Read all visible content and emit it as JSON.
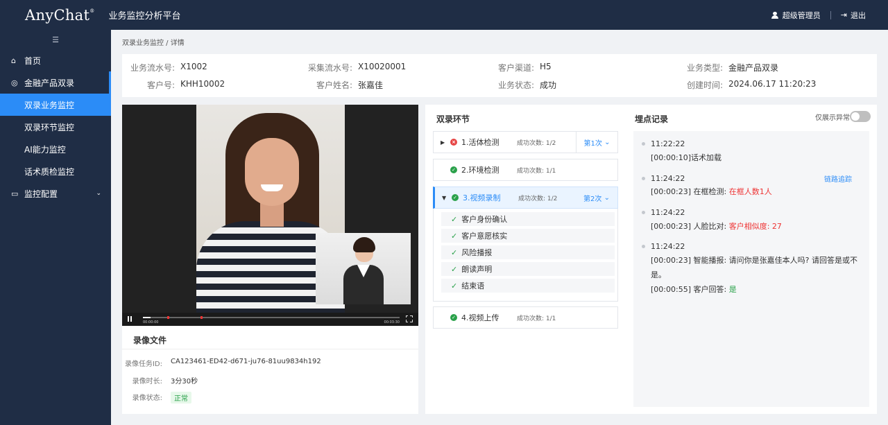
{
  "header": {
    "logo": "AnyChat",
    "logo_mark": "®",
    "platform_title": "业务监控分析平台",
    "user_name": "超级管理员",
    "logout_label": "退出"
  },
  "sidebar": {
    "items": [
      {
        "label": "首页"
      },
      {
        "label": "金融产品双录"
      },
      {
        "label": "双录业务监控"
      },
      {
        "label": "双录环节监控"
      },
      {
        "label": "AI能力监控"
      },
      {
        "label": "话术质检监控"
      },
      {
        "label": "监控配置"
      }
    ]
  },
  "breadcrumb": "双录业务监控 / 详情",
  "info": {
    "fields": [
      {
        "label": "业务流水号:",
        "value": "X1002"
      },
      {
        "label": "采集流水号:",
        "value": "X10020001"
      },
      {
        "label": "客户渠道:",
        "value": "H5"
      },
      {
        "label": "业务类型:",
        "value": "金融产品双录"
      },
      {
        "label": "客户号:",
        "value": "KHH10002"
      },
      {
        "label": "客户姓名:",
        "value": "张嘉佳"
      },
      {
        "label": "业务状态:",
        "value": "成功"
      },
      {
        "label": "创建时间:",
        "value": "2024.06.17  11:20:23"
      }
    ]
  },
  "video": {
    "time_current": "00:00:00",
    "time_total": "00:03:30",
    "progress": 0.03
  },
  "recording": {
    "title": "录像文件",
    "task_id_label": "录像任务ID:",
    "task_id": "CA123461-ED42-d671-ju76-81uu9834h192",
    "duration_label": "录像时长:",
    "duration": "3分30秒",
    "status_label": "录像状态:",
    "status": "正常"
  },
  "steps": {
    "title": "双录环节",
    "items": [
      {
        "name": "1.活体检测",
        "count": "成功次数: 1/2",
        "turn": "第1次"
      },
      {
        "name": "2.环境检测",
        "count": "成功次数: 1/1"
      },
      {
        "name": "3.视频录制",
        "count": "成功次数: 1/2",
        "turn": "第2次"
      },
      {
        "name": "4.视频上传",
        "count": "成功次数: 1/1"
      }
    ],
    "substeps": [
      "客户身份确认",
      "客户意愿核实",
      "风险播报",
      "朗读声明",
      "结束语"
    ]
  },
  "logs": {
    "title": "埋点记录",
    "filter_label": "仅展示异常",
    "trace_label": "链路追踪",
    "entries": [
      {
        "time": "11:22:22",
        "line1": "[00:00:10]话术加载"
      },
      {
        "time": "11:24:22",
        "prefix": "[00:00:23] 在框检测:",
        "highlight": "在框人数1人"
      },
      {
        "time": "11:24:22",
        "prefix": "[00:00:23] 人脸比对:",
        "highlight": "客户相似度: 27"
      },
      {
        "time": "11:24:22",
        "line1": "[00:00:23] 智能播报: 请问你是张嘉佳本人吗? 请回答是或不",
        "line2": "是。",
        "prefix2": "[00:00:55] 客户回答:",
        "answer": "是"
      }
    ]
  }
}
